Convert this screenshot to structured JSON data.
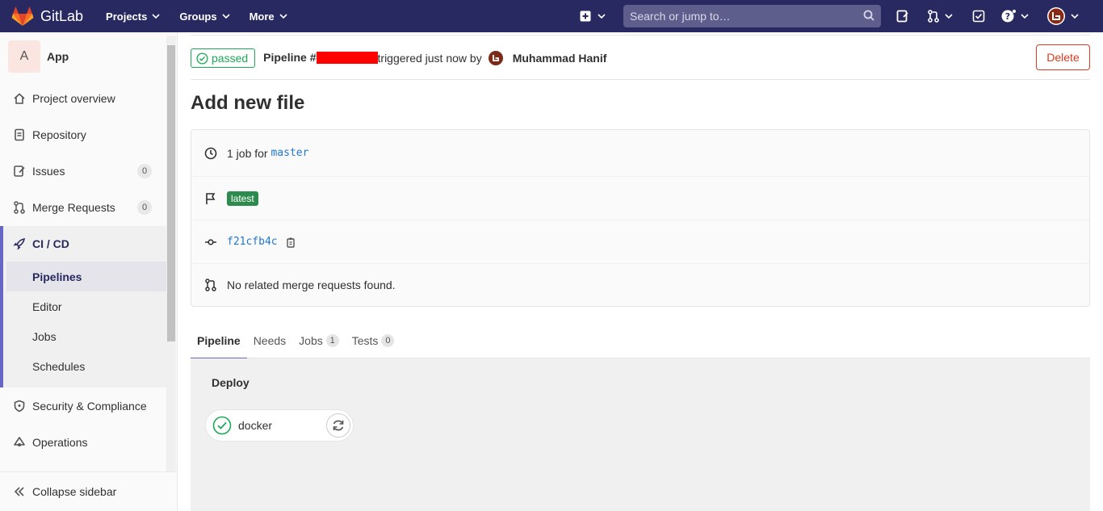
{
  "navbar": {
    "brand": "GitLab",
    "projects": "Projects",
    "groups": "Groups",
    "more": "More",
    "search_placeholder": "Search or jump to…"
  },
  "sidebar": {
    "project_initial": "A",
    "project_name": "App",
    "items": [
      {
        "label": "Project overview",
        "icon": "home-icon"
      },
      {
        "label": "Repository",
        "icon": "doc-icon"
      },
      {
        "label": "Issues",
        "icon": "issues-icon",
        "count": "0"
      },
      {
        "label": "Merge Requests",
        "icon": "merge-request-icon",
        "count": "0"
      }
    ],
    "cicd": {
      "label": "CI / CD",
      "sub": [
        "Pipelines",
        "Editor",
        "Jobs",
        "Schedules"
      ],
      "active": "Pipelines"
    },
    "security": "Security & Compliance",
    "operations": "Operations",
    "collapse": "Collapse sidebar"
  },
  "pipeline": {
    "status": "passed",
    "title_prefix": "Pipeline #",
    "triggered": "triggered just now by",
    "user": "Muhammad Hanif",
    "delete": "Delete",
    "page_title": "Add new file",
    "jobs_text": "1 job for",
    "branch": "master",
    "tag": "latest",
    "commit": "f21cfb4c",
    "merge_text": "No related merge requests found."
  },
  "tabs": [
    {
      "label": "Pipeline"
    },
    {
      "label": "Needs"
    },
    {
      "label": "Jobs",
      "count": "1"
    },
    {
      "label": "Tests",
      "count": "0"
    }
  ],
  "graph": {
    "stage": "Deploy",
    "job": "docker"
  },
  "colors": {
    "navbar": "#292961",
    "success": "#1aaa55",
    "danger": "#db3b21",
    "accent": "#6666c4"
  }
}
